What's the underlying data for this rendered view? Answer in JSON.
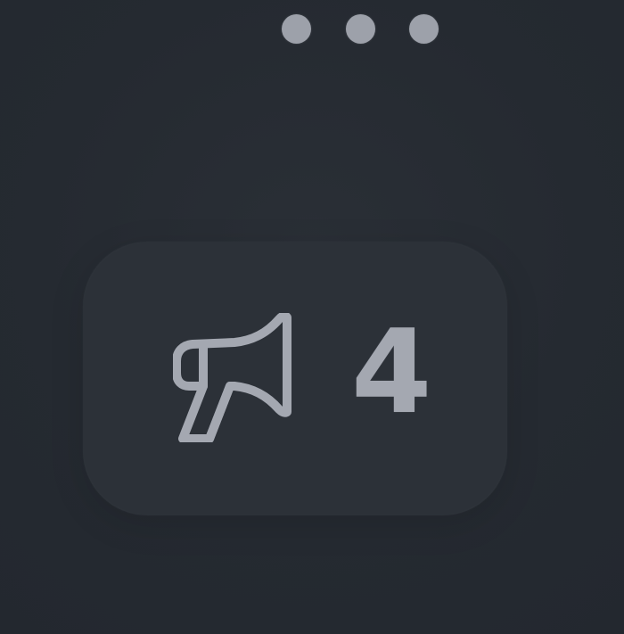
{
  "icons": {
    "more": "more-horizontal-icon",
    "announcement": "megaphone-icon"
  },
  "notification": {
    "count": "4"
  },
  "colors": {
    "background": "#252a31",
    "card": "#2c3138",
    "foreground": "#a4a8b1"
  }
}
